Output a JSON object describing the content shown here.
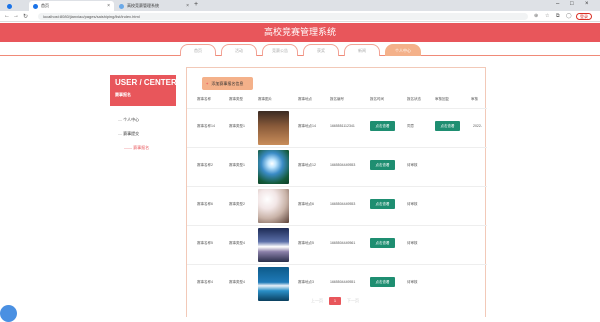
{
  "browser": {
    "tabs": [
      {
        "label": ""
      },
      {
        "label": "首页"
      },
      {
        "label": "高校竞赛管理系统"
      }
    ],
    "url": "localhost:8080/jianxiao/pages/saishiping/list/index.html",
    "new_tab": "+",
    "login_pill": "登录"
  },
  "header": {
    "title": "高校竞赛管理系统"
  },
  "nav": {
    "items": [
      {
        "label": "首页"
      },
      {
        "label": "活动"
      },
      {
        "label": "竞赛公告"
      },
      {
        "label": "获奖"
      },
      {
        "label": "新闻"
      },
      {
        "label": "个人中心"
      }
    ]
  },
  "sidebar": {
    "title": "USER / CENTER",
    "subtitle": "赛事报名",
    "items": [
      {
        "label": "个人中心"
      },
      {
        "label": "赛事提交"
      },
      {
        "label": "赛事报名"
      }
    ]
  },
  "toolbar": {
    "add_label": "添加赛事报名信息"
  },
  "table": {
    "headers": [
      "赛事名称",
      "赛事类型",
      "赛事图片",
      "赛事地点",
      "报名编号",
      "报名时间",
      "报名状态",
      "审核回复",
      "审核"
    ],
    "rows": [
      {
        "name": "赛事名称14",
        "type": "赛事类型1",
        "place": "赛事地点14",
        "id": "1665551112341",
        "action": "点击查看",
        "status": "同意",
        "review": "点击查看",
        "extra": "2022-"
      },
      {
        "name": "赛事名称2",
        "type": "赛事类型1",
        "place": "赛事地点12",
        "id": "1665504449553",
        "action": "点击查看",
        "status": "待审核",
        "review": "",
        "extra": ""
      },
      {
        "name": "赛事名称6",
        "type": "赛事类型2",
        "place": "赛事地点6",
        "id": "1665504449553",
        "action": "点击查看",
        "status": "待审核",
        "review": "",
        "extra": ""
      },
      {
        "name": "赛事名称5",
        "type": "赛事类型4",
        "place": "赛事地点5",
        "id": "1665504449561",
        "action": "点击查看",
        "status": "待审核",
        "review": "",
        "extra": ""
      },
      {
        "name": "赛事名称4",
        "type": "赛事类型4",
        "place": "赛事地点3",
        "id": "1665504449551",
        "action": "点击查看",
        "status": "待审核",
        "review": "",
        "extra": ""
      }
    ]
  },
  "pager": {
    "current": "1",
    "prev": "上一页",
    "next": "下一页"
  },
  "colors": {
    "brand": "#e8565b",
    "accent": "#f4b18a",
    "action": "#1e8e71"
  }
}
